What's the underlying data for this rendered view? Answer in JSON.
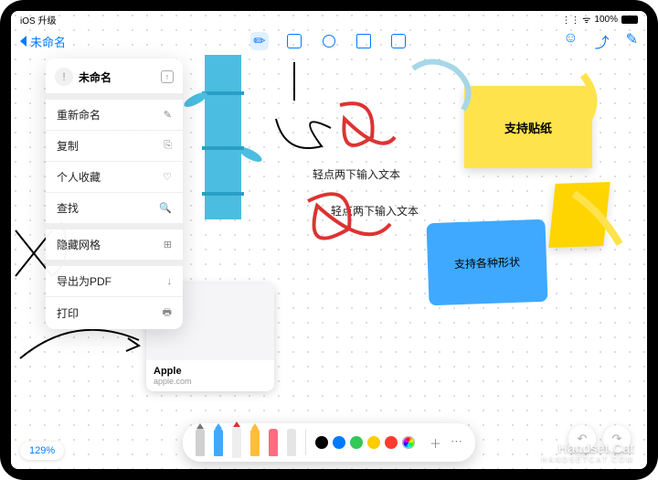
{
  "status": {
    "upgrade": "iOS 升级",
    "battery": "100%"
  },
  "topbar": {
    "back": "未命名"
  },
  "menu": {
    "title": "未命名",
    "items": [
      {
        "label": "重新命名",
        "icon": "✎"
      },
      {
        "label": "复制",
        "icon": "⎘"
      },
      {
        "label": "个人收藏",
        "icon": "♡"
      },
      {
        "label": "查找",
        "icon": "🔍"
      },
      {
        "label": "隐藏网格",
        "icon": "⊞"
      },
      {
        "label": "导出为PDF",
        "icon": "↓"
      },
      {
        "label": "打印",
        "icon": "🖶"
      }
    ]
  },
  "sticky": {
    "note1": "支持贴纸"
  },
  "shape": {
    "label": "支持各种形状"
  },
  "hints": {
    "h1": "轻点两下输入文本",
    "h2": "轻点两下输入文本"
  },
  "card": {
    "title": "Apple",
    "sub": "apple.com",
    "logo": ""
  },
  "zoom": {
    "value": "129%"
  },
  "colors": [
    "#000000",
    "#007aff",
    "#34c759",
    "#ffcc00",
    "#ff3b30"
  ],
  "watermark": {
    "big": "Handset Cat",
    "small": "HANDSETCAT.COM"
  }
}
